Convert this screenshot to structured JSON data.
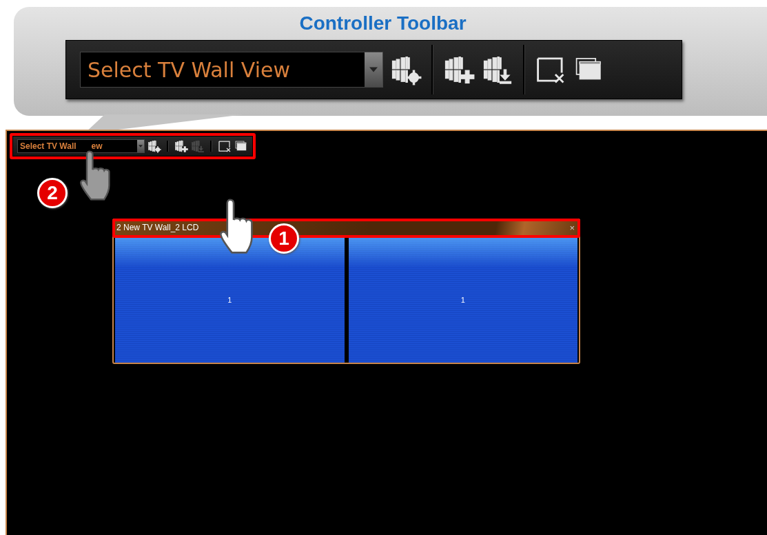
{
  "callout": {
    "title": "Controller Toolbar",
    "toolbar": {
      "dropdown": {
        "value": "Select TV Wall View"
      },
      "groups": [
        {
          "tools": [
            {
              "kind": "wall-settings",
              "disabled": false
            }
          ]
        },
        {
          "tools": [
            {
              "kind": "wall-add",
              "disabled": false
            },
            {
              "kind": "wall-download",
              "disabled": false
            }
          ]
        },
        {
          "tools": [
            {
              "kind": "close-window",
              "disabled": false
            },
            {
              "kind": "cascade",
              "disabled": false
            }
          ]
        }
      ]
    }
  },
  "screen": {
    "toolbar": {
      "dropdown": {
        "value_parts": [
          "Select TV Wall",
          "ew"
        ]
      },
      "groups": [
        {
          "tools": [
            {
              "kind": "wall-settings",
              "disabled": false
            }
          ]
        },
        {
          "tools": [
            {
              "kind": "wall-add",
              "disabled": false
            },
            {
              "kind": "wall-download",
              "disabled": true
            }
          ]
        },
        {
          "tools": [
            {
              "kind": "close-window",
              "disabled": false
            },
            {
              "kind": "cascade",
              "disabled": false
            }
          ]
        }
      ]
    },
    "markers": [
      {
        "number": "2"
      },
      {
        "number": "1"
      }
    ],
    "wall_window": {
      "title": "2 New TV Wall_2 LCD",
      "close": "×",
      "screens": [
        {
          "label": "1"
        },
        {
          "label": "1"
        }
      ]
    }
  }
}
